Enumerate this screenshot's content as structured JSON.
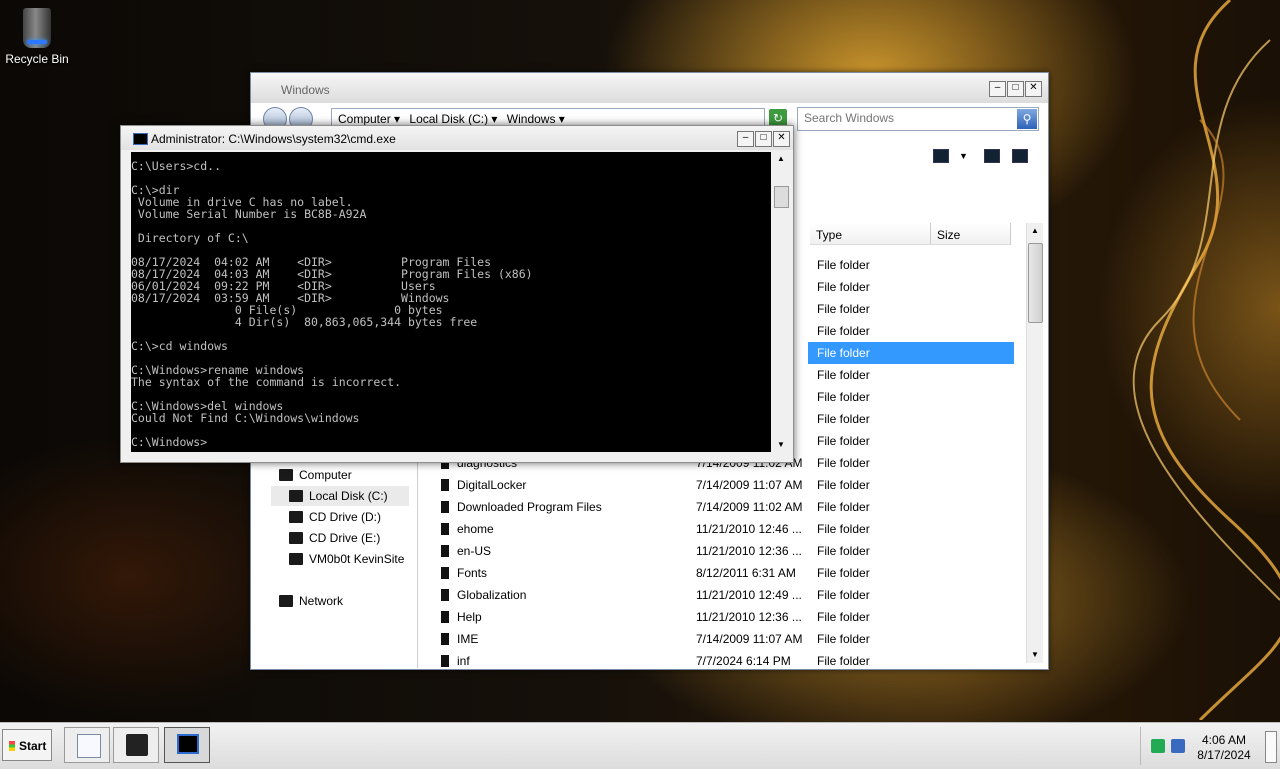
{
  "desktop": {
    "icons": [
      {
        "label": "Recycle Bin",
        "icon": "recycle-bin-icon"
      }
    ]
  },
  "explorer": {
    "title": "Windows",
    "address": {
      "crumbs": [
        "Computer",
        "Local Disk (C:)",
        "Windows"
      ]
    },
    "search": {
      "placeholder": "Search Windows"
    },
    "columns": {
      "type": "Type",
      "size": "Size"
    },
    "rows": [
      {
        "name": "",
        "date": "",
        "type": "File folder",
        "selected": false
      },
      {
        "name": "",
        "date": "",
        "type": "File folder",
        "selected": false
      },
      {
        "name": "",
        "date": "",
        "type": "File folder",
        "selected": false
      },
      {
        "name": "",
        "date": "",
        "type": "File folder",
        "selected": false
      },
      {
        "name": "",
        "date": "",
        "type": "File folder",
        "selected": true
      },
      {
        "name": "",
        "date": "",
        "type": "File folder",
        "selected": false
      },
      {
        "name": "",
        "date": "",
        "type": "File folder",
        "selected": false
      },
      {
        "name": "",
        "date": "",
        "type": "File folder",
        "selected": false
      },
      {
        "name": "",
        "date": "",
        "type": "File folder",
        "selected": false
      },
      {
        "name": "diagnostics",
        "date": "7/14/2009 11:02 AM",
        "type": "File folder",
        "selected": false
      },
      {
        "name": "DigitalLocker",
        "date": "7/14/2009 11:07 AM",
        "type": "File folder",
        "selected": false
      },
      {
        "name": "Downloaded Program Files",
        "date": "7/14/2009 11:02 AM",
        "type": "File folder",
        "selected": false
      },
      {
        "name": "ehome",
        "date": "11/21/2010 12:46 ...",
        "type": "File folder",
        "selected": false
      },
      {
        "name": "en-US",
        "date": "11/21/2010 12:36 ...",
        "type": "File folder",
        "selected": false
      },
      {
        "name": "Fonts",
        "date": "8/12/2011 6:31 AM",
        "type": "File folder",
        "selected": false
      },
      {
        "name": "Globalization",
        "date": "11/21/2010 12:49 ...",
        "type": "File folder",
        "selected": false
      },
      {
        "name": "Help",
        "date": "11/21/2010 12:36 ...",
        "type": "File folder",
        "selected": false
      },
      {
        "name": "IME",
        "date": "7/14/2009 11:07 AM",
        "type": "File folder",
        "selected": false
      },
      {
        "name": "inf",
        "date": "7/7/2024 6:14 PM",
        "type": "File folder",
        "selected": false
      }
    ],
    "nav": [
      {
        "label": "Computer",
        "indent": 0,
        "selected": false,
        "icon": "computer-icon"
      },
      {
        "label": "Local Disk (C:)",
        "indent": 1,
        "selected": true,
        "icon": "hard-drive-icon"
      },
      {
        "label": "CD Drive (D:)",
        "indent": 1,
        "selected": false,
        "icon": "cd-drive-icon"
      },
      {
        "label": "CD Drive (E:)",
        "indent": 1,
        "selected": false,
        "icon": "cd-drive-icon"
      },
      {
        "label": "VM0b0t KevinSite",
        "indent": 1,
        "selected": false,
        "icon": "network-drive-icon"
      },
      {
        "label": "Network",
        "indent": 0,
        "selected": false,
        "icon": "network-icon",
        "gap": true
      }
    ]
  },
  "cmd": {
    "title": "Administrator: C:\\Windows\\system32\\cmd.exe",
    "output": "C:\\Users>cd..\n\nC:\\>dir\n Volume in drive C has no label.\n Volume Serial Number is BC8B-A92A\n\n Directory of C:\\\n\n08/17/2024  04:02 AM    <DIR>          Program Files\n08/17/2024  04:03 AM    <DIR>          Program Files (x86)\n06/01/2024  09:22 PM    <DIR>          Users\n08/17/2024  03:59 AM    <DIR>          Windows\n               0 File(s)              0 bytes\n               4 Dir(s)  80,863,065,344 bytes free\n\nC:\\>cd windows\n\nC:\\Windows>rename windows\nThe syntax of the command is incorrect.\n\nC:\\Windows>del windows\nCould Not Find C:\\Windows\\windows\n\nC:\\Windows>"
  },
  "taskbar": {
    "start_label": "Start",
    "apps": [
      {
        "icon": "notepad-icon",
        "active": false
      },
      {
        "icon": "server-manager-icon",
        "active": false
      },
      {
        "icon": "cmd-icon",
        "active": true
      }
    ],
    "clock": {
      "time": "4:06 AM",
      "date": "8/17/2024"
    }
  },
  "colors": {
    "selection": "#3399ff",
    "cmd_bg": "#000000",
    "cmd_text": "#c0c0c0"
  }
}
